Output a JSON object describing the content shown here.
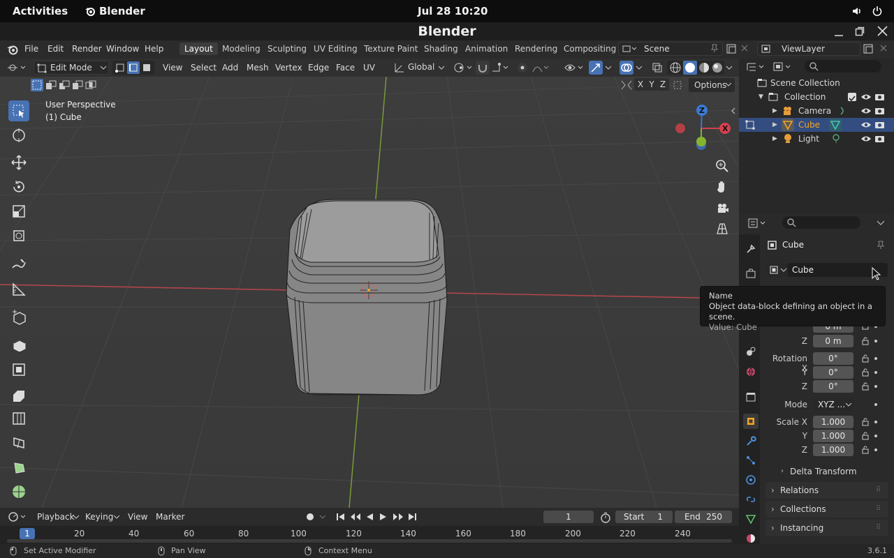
{
  "gnome": {
    "activities": "Activities",
    "app": "Blender",
    "clock": "Jul 28  10:20"
  },
  "window": {
    "title": "Blender"
  },
  "menu": [
    "File",
    "Edit",
    "Render",
    "Window",
    "Help"
  ],
  "workspaces": [
    "Layout",
    "Modeling",
    "Sculpting",
    "UV Editing",
    "Texture Paint",
    "Shading",
    "Animation",
    "Rendering",
    "Compositing"
  ],
  "scene": "Scene",
  "view_layer": "ViewLayer",
  "viewport_header": {
    "mode": "Edit Mode",
    "menus": [
      "View",
      "Select",
      "Add",
      "Mesh",
      "Vertex",
      "Edge",
      "Face",
      "UV"
    ],
    "orientation": "Global",
    "options": "Options",
    "axes": [
      "X",
      "Y",
      "Z"
    ]
  },
  "overlay": {
    "perspective": "User Perspective",
    "object": "(1) Cube"
  },
  "gizmo": {
    "z": "Z",
    "x": "X"
  },
  "outliner": {
    "root": "Scene Collection",
    "collection": "Collection",
    "items": [
      {
        "name": "Camera"
      },
      {
        "name": "Cube"
      },
      {
        "name": "Light"
      }
    ]
  },
  "properties": {
    "object_name_header": "Cube",
    "object_name_field": "Cube",
    "location": {
      "label_z": "Z",
      "z": "0 m",
      "y_partial": "0 m"
    },
    "rotation": {
      "label": "Rotation X",
      "x": "0°",
      "y": "0°",
      "z": "0°",
      "label_y": "Y",
      "label_z": "Z"
    },
    "mode": {
      "label": "Mode",
      "value": "XYZ ..."
    },
    "scale": {
      "label": "Scale X",
      "x": "1.000",
      "y": "1.000",
      "z": "1.000",
      "label_y": "Y",
      "label_z": "Z"
    },
    "panels": [
      "Delta Transform",
      "Relations",
      "Collections",
      "Instancing"
    ]
  },
  "tooltip": {
    "title": "Name",
    "description": "Object data-block defining an object in a scene.",
    "value": "Value: Cube"
  },
  "timeline": {
    "menus": [
      "Playback",
      "Keying",
      "View",
      "Marker"
    ],
    "current_frame": "1",
    "start_label": "Start",
    "start": "1",
    "end_label": "End",
    "end": "250",
    "ruler_current": "1",
    "ruler_ticks": [
      "20",
      "40",
      "60",
      "80",
      "100",
      "120",
      "140",
      "160",
      "180",
      "200",
      "220",
      "240"
    ]
  },
  "status": {
    "left": "Set Active Modifier",
    "middle": "Pan View",
    "right": "Context Menu",
    "version": "3.6.1"
  },
  "colors": {
    "accent": "#4772b3",
    "selected_row": "#334d80",
    "cube_highlight": "#f5a623"
  }
}
